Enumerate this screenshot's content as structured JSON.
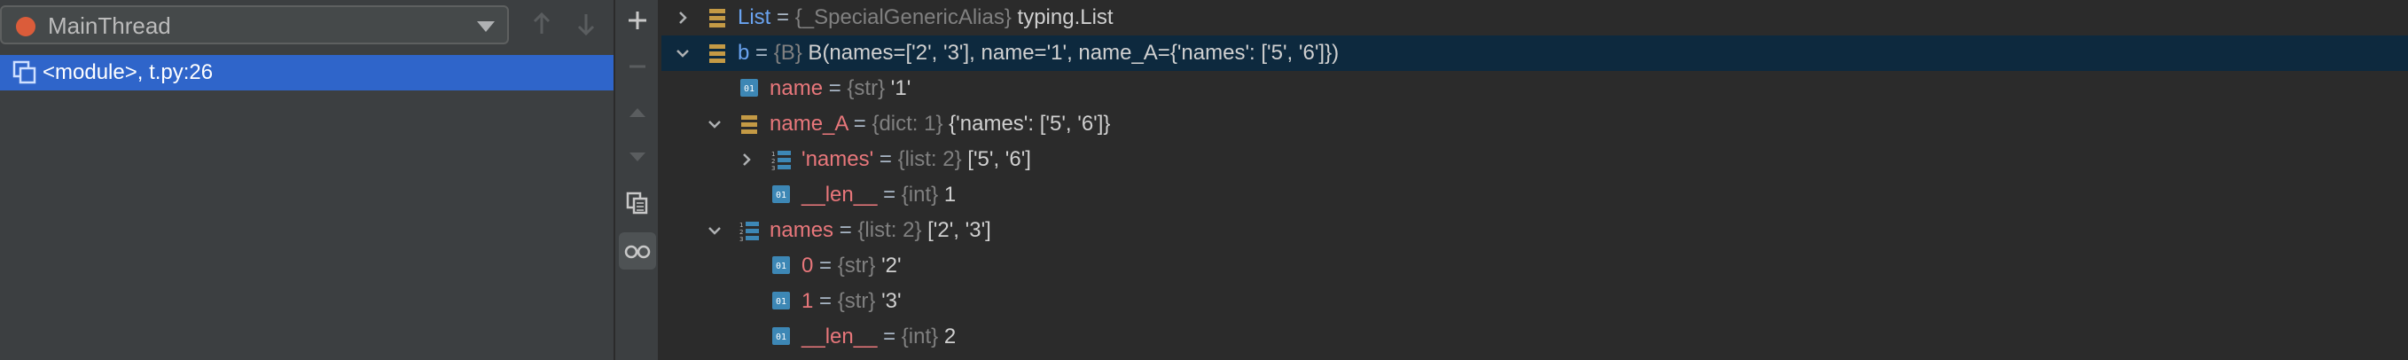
{
  "thread": {
    "name": "MainThread"
  },
  "frames": [
    {
      "label": "<module>, t.py:26"
    }
  ],
  "variables": [
    {
      "name": "List",
      "eq": " = ",
      "type": "{_SpecialGenericAlias}",
      "value": " typing.List"
    },
    {
      "name": "b",
      "eq": " = ",
      "type": "{B}",
      "value": " B(names=['2', '3'], name='1', name_A={'names': ['5', '6']})"
    },
    {
      "name": "name",
      "eq": " = ",
      "type": "{str}",
      "value": " '1'"
    },
    {
      "name": "name_A",
      "eq": " = ",
      "type": "{dict: 1}",
      "value": " {'names': ['5', '6']}"
    },
    {
      "name": "'names'",
      "eq": " = ",
      "type": "{list: 2}",
      "value": " ['5', '6']"
    },
    {
      "name": "__len__",
      "eq": " = ",
      "type": "{int}",
      "value": " 1"
    },
    {
      "name": "names",
      "eq": " = ",
      "type": "{list: 2}",
      "value": " ['2', '3']"
    },
    {
      "name": "0",
      "eq": " = ",
      "type": "{str}",
      "value": " '2'"
    },
    {
      "name": "1",
      "eq": " = ",
      "type": "{str}",
      "value": " '3'"
    },
    {
      "name": "__len__",
      "eq": " = ",
      "type": "{int}",
      "value": " 2"
    }
  ],
  "colors": {
    "selection": "#2f65ca",
    "selected_row": "#0d293e",
    "name_blue": "#6aa3f0",
    "name_red": "#e8777b",
    "thread_dot": "#db5c3a"
  },
  "icons": [
    "plus-icon",
    "minus-icon",
    "up-arrow-icon",
    "down-arrow-icon",
    "copy-icon",
    "glasses-icon",
    "chevron-right-icon",
    "chevron-down-icon",
    "object-icon",
    "list-icon",
    "primitive-icon"
  ]
}
